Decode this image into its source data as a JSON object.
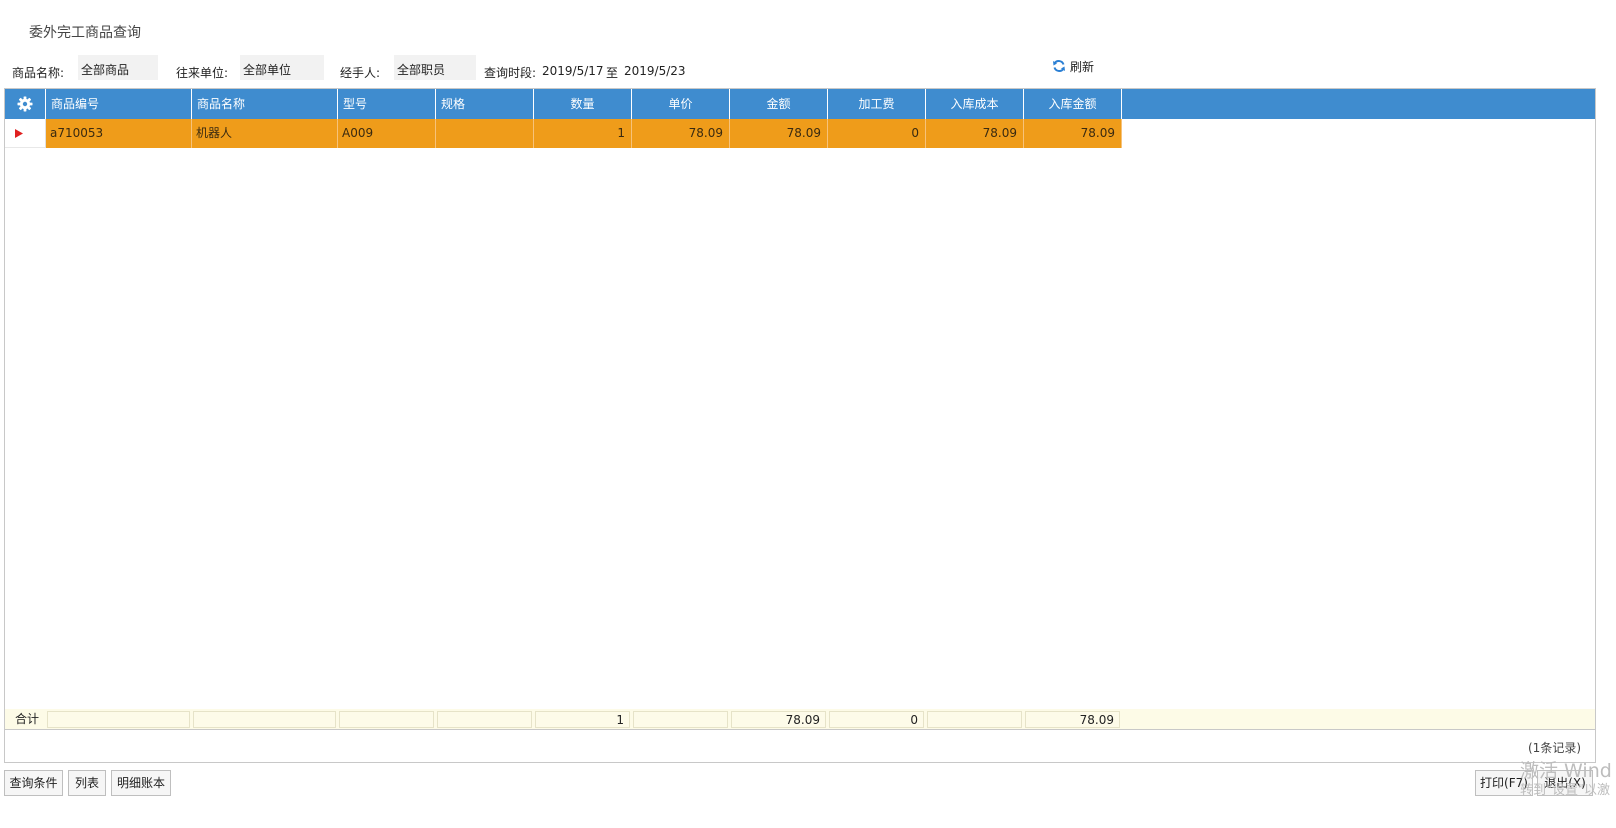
{
  "page": {
    "title": "委外完工商品查询"
  },
  "filters": {
    "product_name_label": "商品名称:",
    "product_name_value": "全部商品",
    "partner_label": "往来单位:",
    "partner_value": "全部单位",
    "handler_label": "经手人:",
    "handler_value": "全部职员",
    "period_label": "查询时段:",
    "period_start": "2019/5/17",
    "period_to": "至",
    "period_end": "2019/5/23",
    "refresh_label": "刷新"
  },
  "table": {
    "settings_icon": "gear-icon",
    "columns": [
      "商品编号",
      "商品名称",
      "型号",
      "规格",
      "数量",
      "单价",
      "金额",
      "加工费",
      "入库成本",
      "入库金额"
    ],
    "rows": [
      [
        "a710053",
        "机器人",
        "A009",
        "",
        "1",
        "78.09",
        "78.09",
        "0",
        "78.09",
        "78.09"
      ]
    ],
    "selected_row_color": "#ef9c1a",
    "header_color": "#3f8ccf",
    "summary": {
      "label": "合计",
      "values": [
        "",
        "",
        "",
        "",
        "1",
        "",
        "78.09",
        "0",
        "",
        "78.09"
      ]
    },
    "record_count": "(1条记录)"
  },
  "buttons": {
    "query_conditions": "查询条件",
    "list": "列表",
    "detail_ledger": "明细账本",
    "print": "打印(F7)",
    "exit": "退出(X)"
  },
  "watermark": {
    "line1": "激活 Wind",
    "line2": "转到\"设置\"以激"
  }
}
